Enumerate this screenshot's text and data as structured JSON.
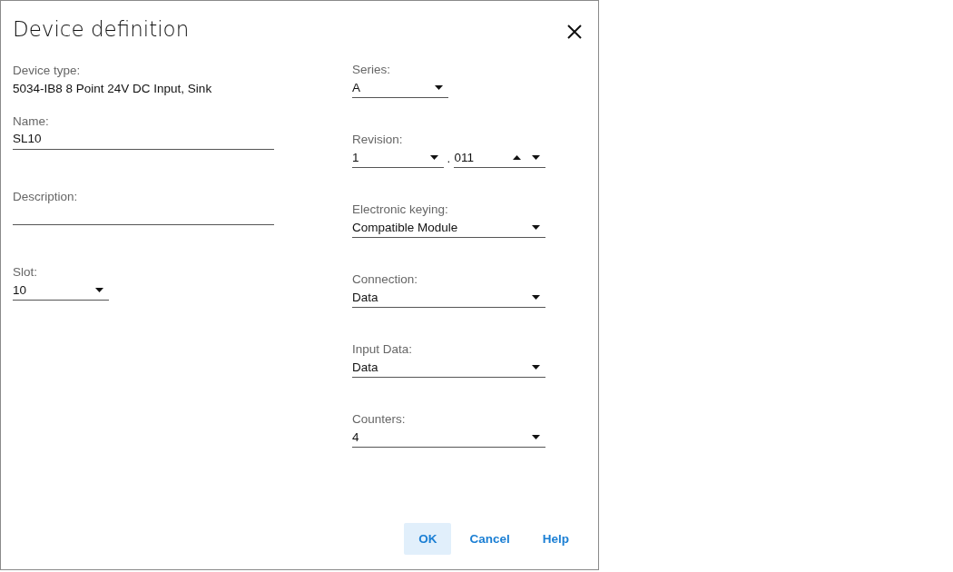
{
  "dialog": {
    "title": "Device definition"
  },
  "device_type": {
    "label": "Device type:",
    "value": "5034-IB8 8 Point 24V DC Input, Sink"
  },
  "left_fields": [
    {
      "kind": "text",
      "label": "Name:",
      "value": "SL10"
    },
    {
      "kind": "text",
      "label": "Description:"
    },
    {
      "kind": "dropdown",
      "label": "Slot:",
      "value": "10"
    }
  ],
  "right_fields": [
    {
      "kind": "dropdown",
      "label": "Series:",
      "value": "A"
    },
    {
      "kind": "revision",
      "label": "Revision:",
      "major": "1",
      "separator": ".",
      "minor": "011"
    },
    {
      "kind": "dropdown",
      "label": "Electronic keying:",
      "value": "Compatible Module"
    },
    {
      "kind": "dropdown",
      "label": "Connection:",
      "value": "Data"
    },
    {
      "kind": "dropdown",
      "label": "Input Data:",
      "value": "Data"
    },
    {
      "kind": "dropdown",
      "label": "Counters:",
      "value": "4"
    }
  ],
  "buttons": [
    {
      "label": "OK",
      "selected": true
    },
    {
      "label": "Cancel",
      "selected": false
    },
    {
      "label": "Help",
      "selected": false
    }
  ]
}
